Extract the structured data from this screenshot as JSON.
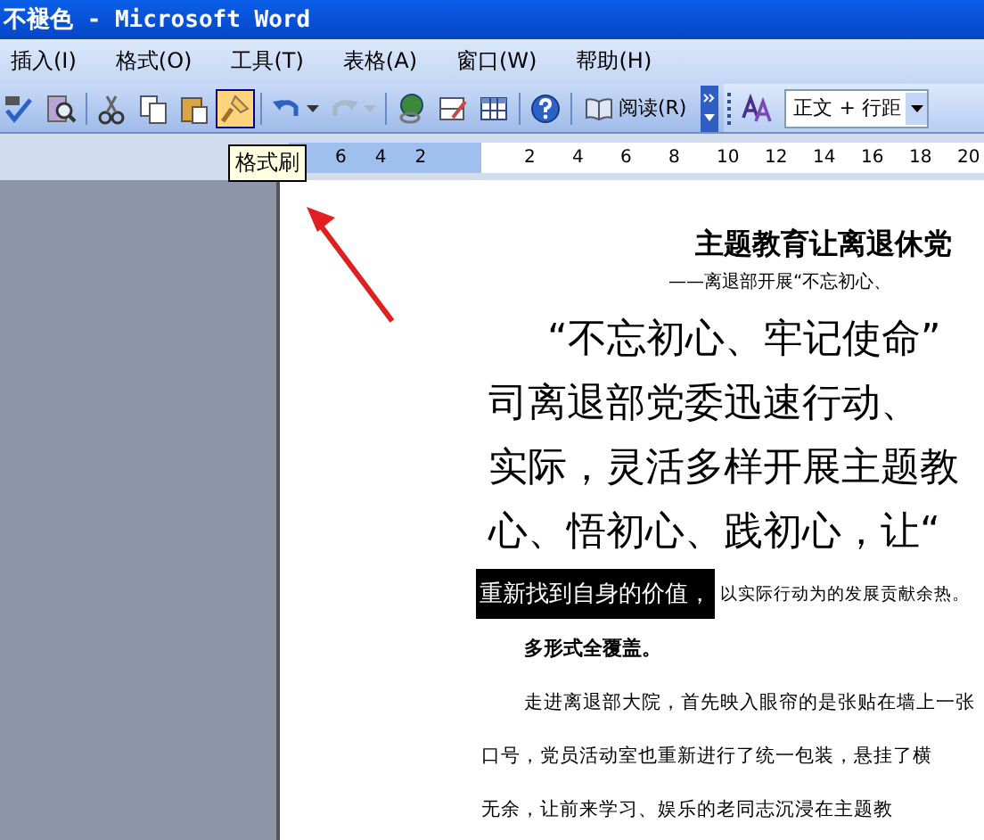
{
  "window": {
    "title": "不褪色 - Microsoft Word"
  },
  "menu": [
    {
      "label": "插入(I)"
    },
    {
      "label": "格式(O)"
    },
    {
      "label": "工具(T)"
    },
    {
      "label": "表格(A)"
    },
    {
      "label": "窗口(W)"
    },
    {
      "label": "帮助(H)"
    }
  ],
  "toolbar": [
    {
      "kind": "spelling",
      "selected": false,
      "disabled": false
    },
    {
      "kind": "research",
      "selected": false,
      "disabled": false
    },
    {
      "kind": "sep"
    },
    {
      "kind": "cut",
      "selected": false,
      "disabled": false
    },
    {
      "kind": "copy",
      "selected": false,
      "disabled": false
    },
    {
      "kind": "paste",
      "selected": false,
      "disabled": false
    },
    {
      "kind": "format-painter",
      "selected": true,
      "disabled": false
    },
    {
      "kind": "sep"
    },
    {
      "kind": "undo",
      "selected": false,
      "disabled": false
    },
    {
      "kind": "redo",
      "selected": false,
      "disabled": true
    },
    {
      "kind": "sep"
    },
    {
      "kind": "hyperlink",
      "selected": false,
      "disabled": false
    },
    {
      "kind": "tables-borders",
      "selected": false,
      "disabled": false
    },
    {
      "kind": "table",
      "selected": false,
      "disabled": false
    },
    {
      "kind": "sep"
    },
    {
      "kind": "help",
      "selected": false,
      "disabled": false
    },
    {
      "kind": "sep"
    },
    {
      "kind": "reading",
      "label": "阅读(R)",
      "selected": false,
      "disabled": false
    }
  ],
  "style_box": {
    "value": "正文 + 行距"
  },
  "tooltip": "格式刷",
  "ruler": {
    "left_ticks": [
      "6",
      "4",
      "2"
    ],
    "right_ticks": [
      "2",
      "4",
      "6",
      "8",
      "10",
      "12",
      "14",
      "16",
      "18",
      "20"
    ]
  },
  "document": {
    "title": "主题教育让离退休党",
    "subtitle": "——离退部开展“不忘初心、",
    "large_lines": [
      "“不忘初心、牢记使命”",
      "司离退部党委迅速行动、",
      "实际，灵活多样开展主题教",
      "心、悟初心、践初心，让“"
    ],
    "selected_text": "重新找到自身的价值，",
    "after_selection": "以实际行动为的发展贡献余热。",
    "heading": "多形式全覆盖。",
    "small_lines": [
      "走进离退部大院，首先映入眼帘的是张贴在墙上一张",
      "口号，党员活动室也重新进行了统一包装，悬挂了横",
      "无余，让前来学习、娱乐的老同志沉浸在主题教"
    ]
  }
}
